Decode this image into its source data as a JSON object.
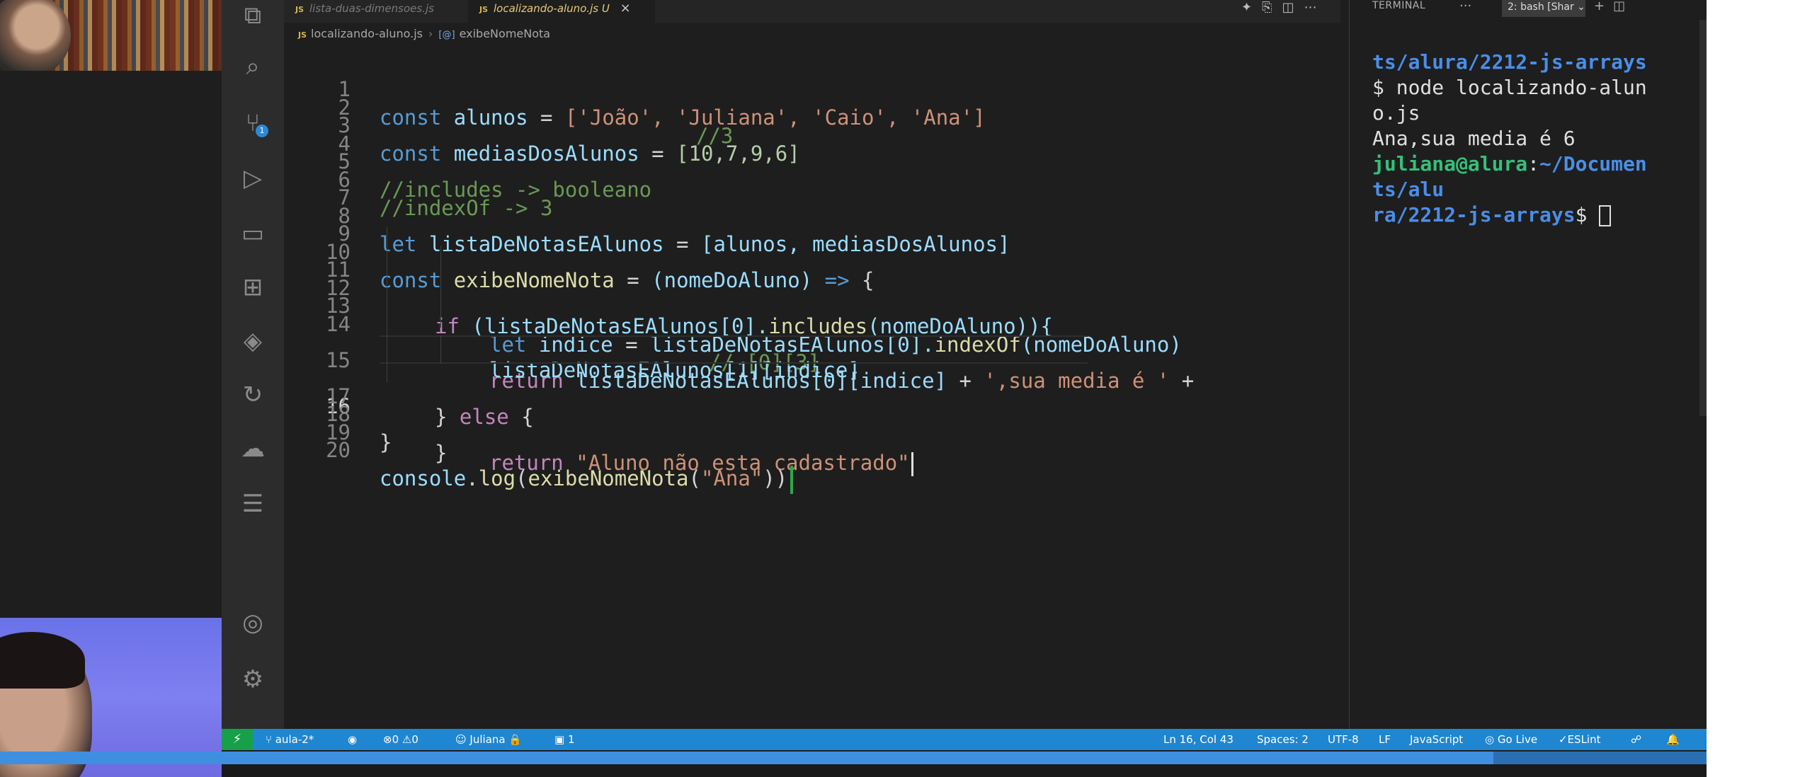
{
  "tabs": [
    {
      "label": "lista-duas-dimensoes.js",
      "active": false
    },
    {
      "label": "localizando-aluno.js",
      "modified": "U",
      "active": true
    }
  ],
  "breadcrumb": {
    "file": "localizando-aluno.js",
    "symbol": "exibeNomeNota"
  },
  "code": {
    "l1": "1",
    "l2": "2",
    "l3": "3",
    "l4": "4",
    "l5": "5",
    "l6": "6",
    "l7": "7",
    "l8": "8",
    "l9": "9",
    "l10": "10",
    "l11": "11",
    "l12": "12",
    "l13": "13",
    "l14": "14",
    "l15": "15",
    "l16": "16",
    "l17": "17",
    "l18": "18",
    "l19": "19",
    "l20": "20",
    "t_const": "const",
    "t_let": "let",
    "t_if": "if",
    "t_return": "return",
    "t_else": "else",
    "t_arrow": "=>",
    "alunos_var": "alunos",
    "alunos_arr": "['João', 'Juliana', 'Caio', 'Ana']",
    "c_3": "//3",
    "medias_var": "mediasDosAlunos",
    "medias_arr": "[10,7,9,6]",
    "c_includes": "//includes -> booleano",
    "c_indexof": "//indexOf -> 3",
    "lista_var": "listaDeNotasEAlunos",
    "lista_val": "[alunos, mediasDosAlunos]",
    "fn_name": "exibeNomeNota",
    "fn_params": "(nomeDoAluno)",
    "if_expr_a": "(listaDeNotasEAlunos[0].",
    "if_call": "includes",
    "if_expr_b": "(nomeDoAluno)){",
    "indice_var": "indice",
    "idx_expr_a": "listaDeNotasEAlunos[0].",
    "idx_call": "indexOf",
    "idx_expr_b": "(nomeDoAluno)",
    "c_03": "// [0][3]",
    "ret_expr": "listaDeNotasEAlunos[0][indice]",
    "ret_str": "',sua media é '",
    "ret_cont": "listaDeNotasEAlunos[1][indice]",
    "ret2_str": "\"Aluno não esta cadastrado\"",
    "console_obj": "console",
    "console_log": "log",
    "console_call": "exibeNomeNota",
    "console_arg": "\"Ana\""
  },
  "terminal": {
    "title": "TERMINAL",
    "more": "···",
    "shell_select": "2: bash [Shar",
    "line1": "ts/alura/2212-js-arrays",
    "line2": "$ node localizando-alun",
    "line3": "o.js",
    "line4": "Ana,sua media é 6",
    "line5_user": "juliana@alura",
    "line5_path": "~/Documen",
    "line6": "ts/alu",
    "line7_path": "ra/2212-js-arrays",
    "line7_prompt": "$ "
  },
  "statusbar": {
    "branch": "aula-2*",
    "problems": "0",
    "warnings": "0",
    "liveshare_user": "Juliana",
    "ports": "1",
    "position": "Ln 16, Col 43",
    "spaces": "Spaces: 2",
    "encoding": "UTF-8",
    "eol": "LF",
    "language": "JavaScript",
    "golive": "Go Live",
    "eslint": "ESLint"
  },
  "video": {
    "progress": 0.875
  }
}
